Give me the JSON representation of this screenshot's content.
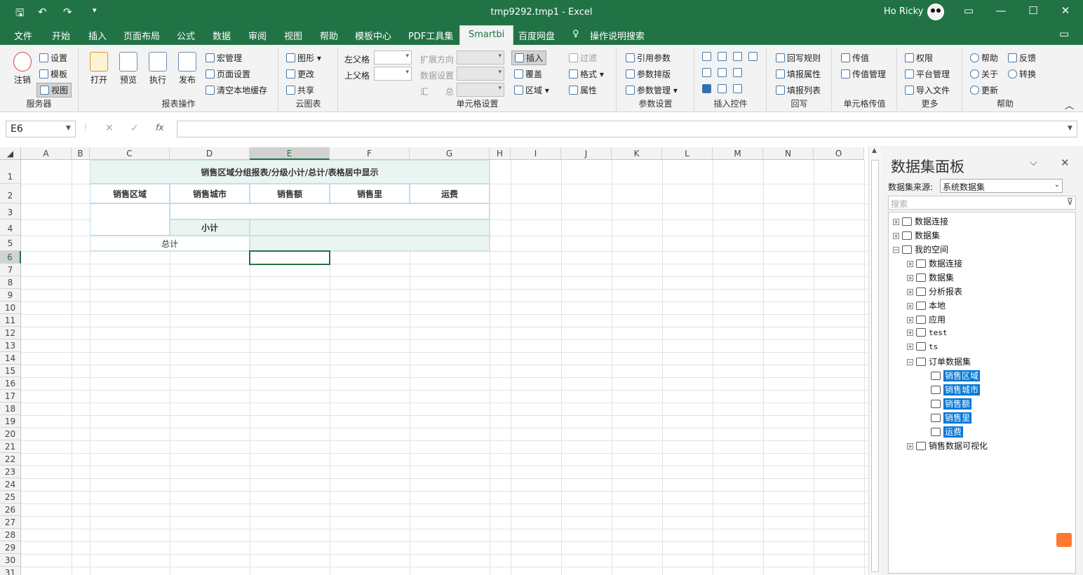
{
  "window": {
    "title": "tmp9292.tmp1  -  Excel",
    "user": "Ho Ricky"
  },
  "menu": [
    "文件",
    "开始",
    "插入",
    "页面布局",
    "公式",
    "数据",
    "审阅",
    "视图",
    "帮助",
    "模板中心",
    "PDF工具集",
    "Smartbi",
    "百度网盘",
    "操作说明搜索"
  ],
  "ribbon": {
    "server": {
      "label": "服务器",
      "logout": "注销",
      "settings": "设置",
      "template": "模板",
      "view": "视图"
    },
    "report_ops": {
      "label": "报表操作",
      "open": "打开",
      "preview": "预览",
      "execute": "执行",
      "publish": "发布",
      "macro": "宏管理",
      "page_setup": "页面设置",
      "clear_cache": "清空本地缓存"
    },
    "cloud_chart": {
      "label": "云图表",
      "chart": "图形",
      "change": "更改",
      "share": "共享"
    },
    "cell_settings": {
      "label": "单元格设置",
      "left_parent": "左父格",
      "top_parent": "上父格",
      "expand_dir": "扩展方向",
      "data_settings": "数据设置",
      "summary": "汇　　总",
      "insert": "插入",
      "overwrite": "覆盖",
      "area": "区域",
      "filter": "过滤",
      "format": "格式",
      "attribute": "属性"
    },
    "param_settings": {
      "label": "参数设置",
      "ref_param": "引用参数",
      "param_layout": "参数排版",
      "param_manage": "参数管理"
    },
    "insert_control": {
      "label": "插入控件"
    },
    "writeback": {
      "label": "回写",
      "rules": "回写规则",
      "fill_attr": "填报属性",
      "fill_list": "填报列表"
    },
    "cell_pass": {
      "label": "单元格传值",
      "pass": "传值",
      "pass_manage": "传值管理"
    },
    "more": {
      "label": "更多",
      "perm": "权限",
      "platform": "平台管理",
      "import": "导入文件"
    },
    "help": {
      "label": "帮助",
      "help": "帮助",
      "feedback": "反馈",
      "about": "关于",
      "convert": "转换",
      "update": "更新"
    }
  },
  "formula": {
    "namebox": "E6",
    "fx": "fx",
    "content": ""
  },
  "sheet": {
    "columns": [
      "A",
      "B",
      "C",
      "D",
      "E",
      "F",
      "G",
      "H",
      "I",
      "J",
      "K",
      "L",
      "M",
      "N",
      "O"
    ],
    "rows": [
      "1",
      "2",
      "3",
      "4",
      "5",
      "6",
      "7",
      "8",
      "9",
      "10",
      "11",
      "12",
      "13",
      "14",
      "15",
      "16",
      "17",
      "18",
      "19",
      "20",
      "21",
      "22",
      "23",
      "24",
      "25",
      "26",
      "27",
      "28",
      "29",
      "30",
      "31"
    ],
    "title": "销售区域分组报表/分级小计/总计/表格居中显示",
    "headers": [
      "销售区域",
      "销售城市",
      "销售额",
      "销售里",
      "运费"
    ],
    "subtotal": "小计",
    "total": "总计"
  },
  "panel": {
    "title": "数据集面板",
    "source_label": "数据集来源:",
    "source_value": "系统数据集",
    "search_placeholder": "搜索",
    "tree": {
      "n1": "数据连接",
      "n2": "数据集",
      "n3": "我的空间",
      "n4": "数据连接",
      "n5": "数据集",
      "n6": "分析报表",
      "n7": "本地",
      "n8": "应用",
      "n9": "test",
      "n10": "ts",
      "n11": "订单数据集",
      "f1": "销售区域",
      "f2": "销售城市",
      "f3": "销售额",
      "f4": "销售里",
      "f5": "运费",
      "n12": "销售数据可视化"
    }
  }
}
